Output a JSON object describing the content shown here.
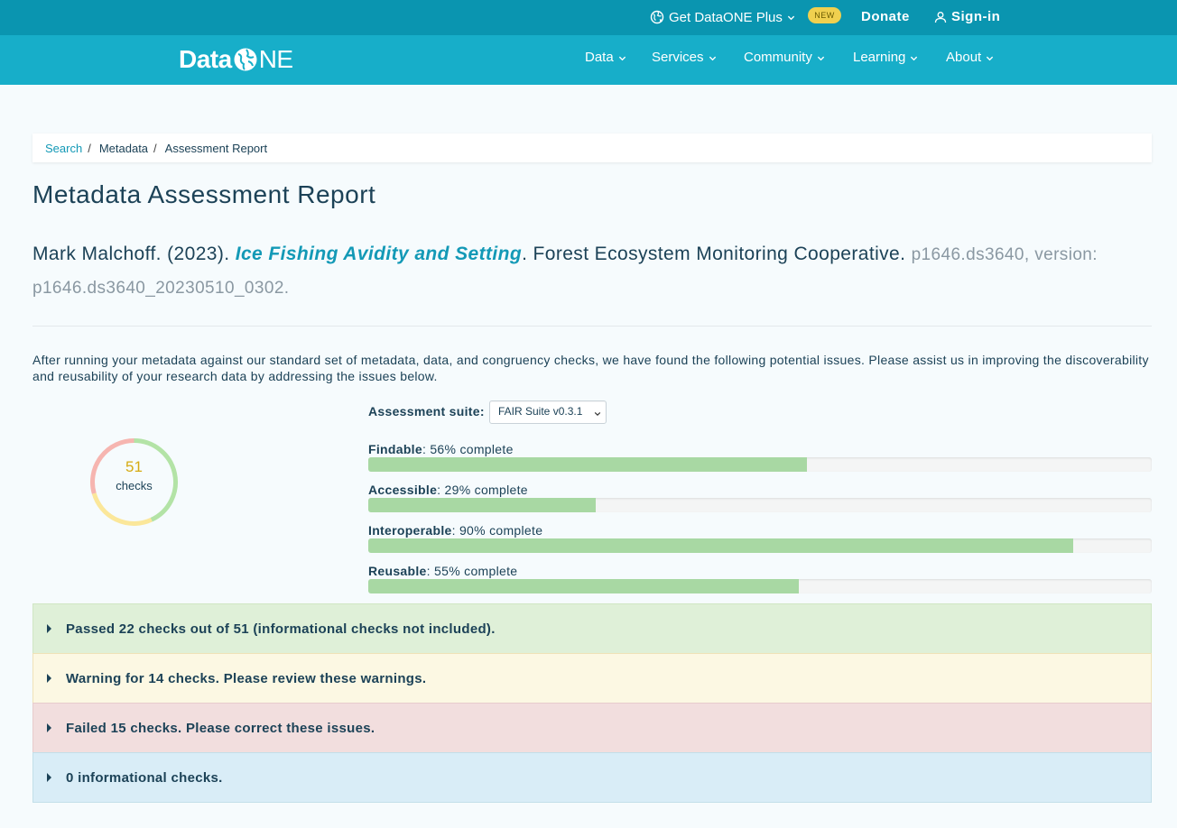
{
  "topbar": {
    "plus_label": "Get DataONE Plus",
    "new_badge": "NEW",
    "donate": "Donate",
    "signin": "Sign-in"
  },
  "navbar": {
    "logo_a": "Data",
    "logo_b": "NE",
    "items": [
      "Data",
      "Services",
      "Community",
      "Learning",
      "About"
    ]
  },
  "breadcrumb": {
    "items": [
      "Search",
      "Metadata",
      "Assessment Report"
    ],
    "separator": "/"
  },
  "page": {
    "title": "Metadata Assessment Report"
  },
  "citation": {
    "authors": "Mark Malchoff. (2023). ",
    "title": "Ice Fishing Avidity and Setting",
    "after_title": ". Forest Ecosystem Monitoring Cooperative. ",
    "identifier": "p1646.ds3640, version: p1646.ds3640_20230510_0302."
  },
  "intro": "After running your metadata against our standard set of metadata, data, and congruency checks, we have found the following potential issues. Please assist us in improving the discoverability and reusability of your research data by addressing the issues below.",
  "summary": {
    "count": "51",
    "count_label": "checks",
    "passed": 22,
    "warnings": 14,
    "failed": 15,
    "colors": {
      "passed": "#b3e3a6",
      "warnings": "#fbe79a",
      "failed": "#f6b5b0"
    }
  },
  "suite": {
    "label": "Assessment suite:",
    "selected": "FAIR Suite v0.3.1"
  },
  "progress": [
    {
      "name": "Findable",
      "pct": 56,
      "suffix": ": 56% complete"
    },
    {
      "name": "Accessible",
      "pct": 29,
      "suffix": ": 29% complete"
    },
    {
      "name": "Interoperable",
      "pct": 90,
      "suffix": ": 90% complete"
    },
    {
      "name": "Reusable",
      "pct": 55,
      "suffix": ": 55% complete"
    }
  ],
  "panels": {
    "passed": "Passed 22 checks out of 51 (informational checks not included).",
    "warning": "Warning for 14 checks. Please review these warnings.",
    "failed": "Failed 15 checks. Please correct these issues.",
    "info": "0 informational checks."
  }
}
